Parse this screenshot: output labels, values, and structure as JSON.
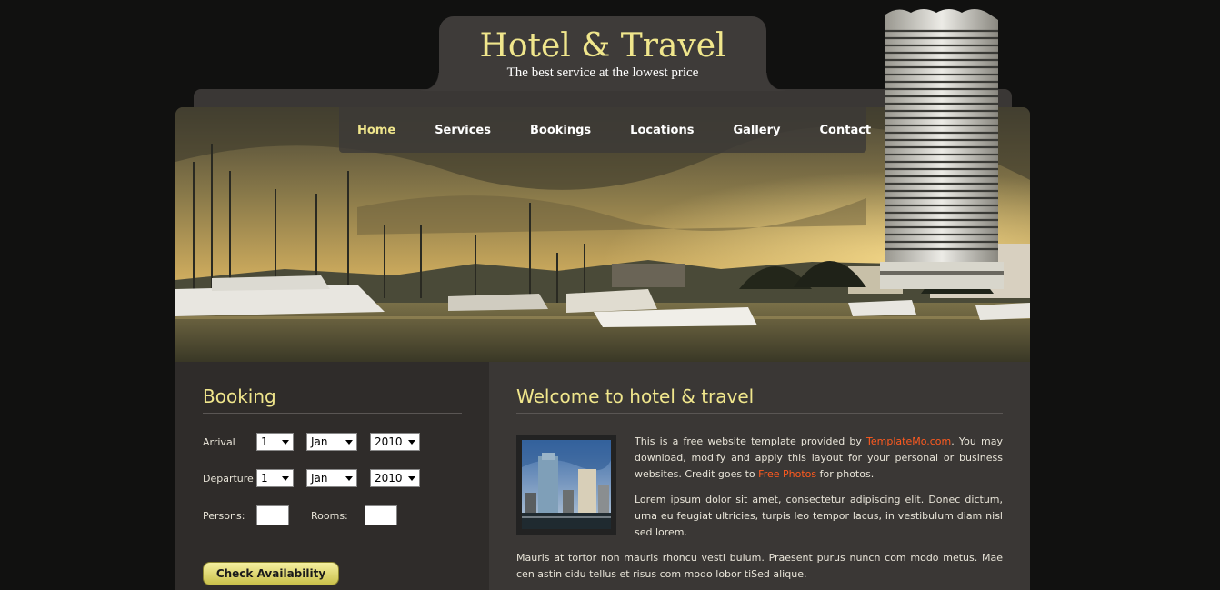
{
  "header": {
    "title": "Hotel & Travel",
    "tagline": "The best service at the lowest price"
  },
  "nav": {
    "items": [
      "Home",
      "Services",
      "Bookings",
      "Locations",
      "Gallery",
      "Contact"
    ],
    "active": "Home"
  },
  "booking": {
    "title": "Booking",
    "arrival_label": "Arrival",
    "departure_label": "Departure",
    "persons_label": "Persons:",
    "rooms_label": "Rooms:",
    "arrival_day": "1",
    "arrival_month": "Jan",
    "arrival_year": "2010",
    "departure_day": "1",
    "departure_month": "Jan",
    "departure_year": "2010",
    "persons_value": "",
    "rooms_value": "",
    "button_label": "Check Availability"
  },
  "welcome": {
    "title": "Welcome to hotel & travel",
    "p1_pre": "This is a free website template provided by ",
    "p1_link1": "TemplateMo.com",
    "p1_mid": ". You may download, modify and apply this layout for your personal or business websites. Credit goes to ",
    "p1_link2": "Free Photos",
    "p1_post": " for photos.",
    "p2": "Lorem ipsum dolor sit amet, consectetur adipiscing elit. Donec dictum, urna eu feugiat ultricies, turpis leo tempor lacus, in vestibulum diam nisl sed lorem.",
    "p3": "Mauris at tortor non mauris rhoncu vesti bulum. Praesent purus nuncn com modo metus. Mae cen astin cidu tellus et risus com modo lobor tiSed alique."
  },
  "colors": {
    "accent": "#f0e68c",
    "link": "#ff5a1f",
    "background": "#111110"
  }
}
